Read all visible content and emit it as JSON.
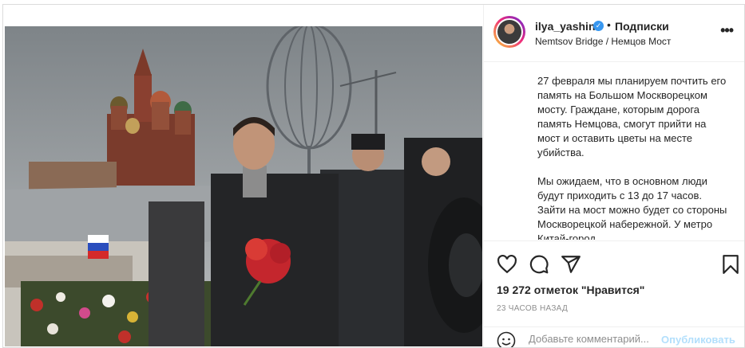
{
  "post": {
    "username": "ilya_yashin",
    "follow_label": "Подписки",
    "location": "Nemtsov Bridge / Немцов Мост",
    "caption_paragraphs": [
      "27 февраля мы планируем почтить его память на Большом Москворецком мосту. Граждане, которым дорога память Немцова, смогут прийти на мост и оставить цветы на месте убийства.",
      "Мы ожидаем, что в основном люди будут приходить с 13 до 17 часов. Зайти на мост можно будет со стороны Москворецкой набережной. У метро Китай-город."
    ],
    "likes_text": "19 272 отметок \"Нравится\"",
    "time_ago": "23 ЧАСОВ НАЗАД",
    "comment_placeholder": "Добавьте комментарий...",
    "publish_label": "Опубликовать"
  },
  "icons": {
    "verified": "verified-badge-icon",
    "more": "more-options-icon",
    "like": "heart-icon",
    "comment": "comment-icon",
    "share": "share-icon",
    "save": "bookmark-icon",
    "emoji": "emoji-icon"
  },
  "colors": {
    "link_blue": "#3897f0",
    "publish_disabled": "#b2dffc",
    "muted": "#8e8e8e"
  }
}
